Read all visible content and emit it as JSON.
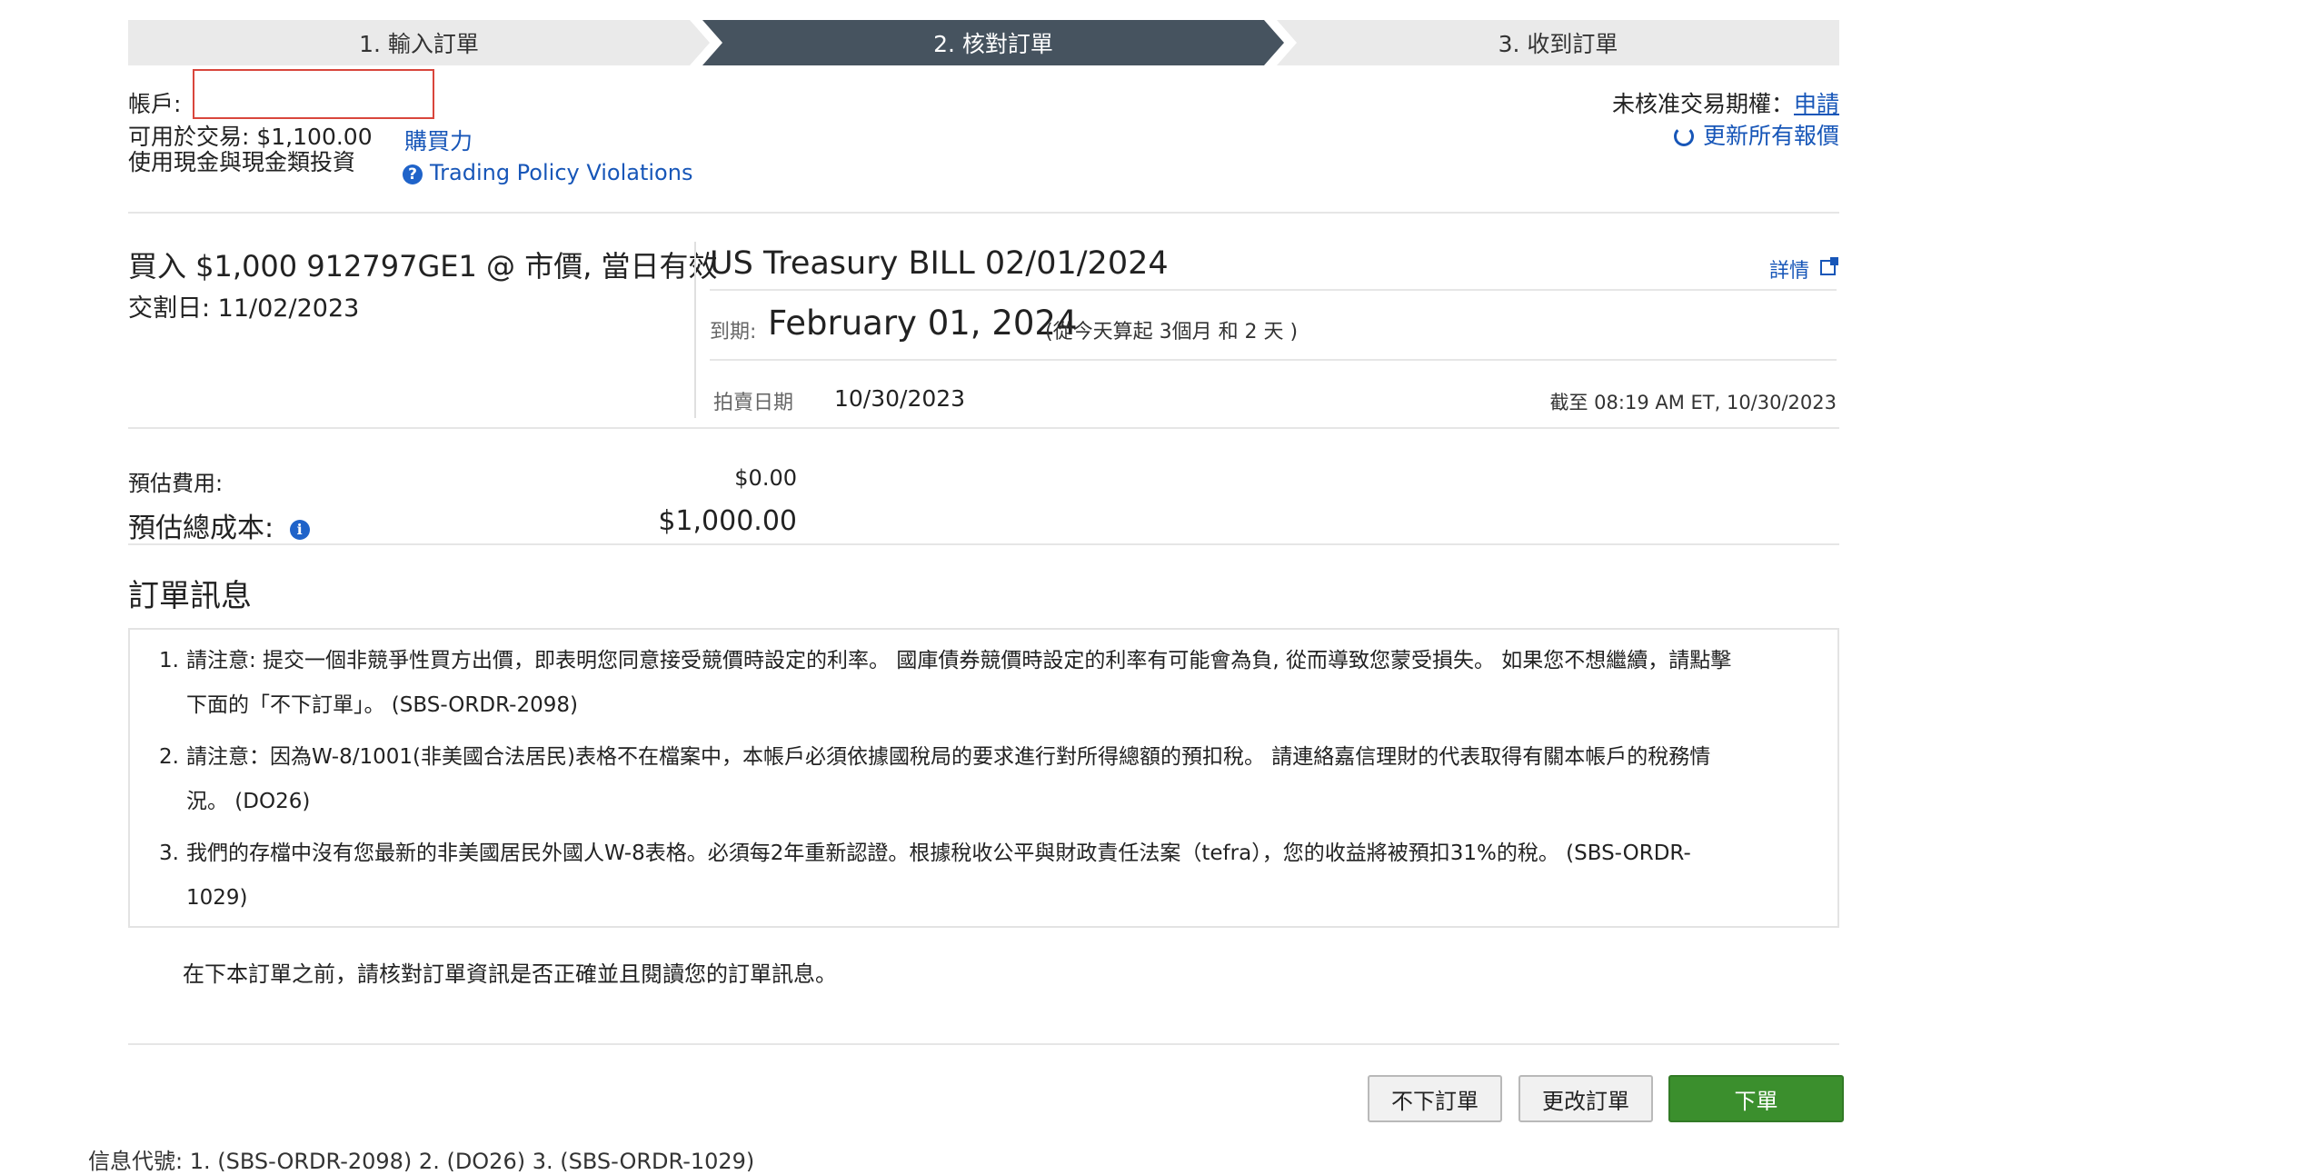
{
  "steps": [
    "1. 輸入訂單",
    "2. 核對訂單",
    "3. 收到訂單"
  ],
  "account": {
    "label": "帳戶:",
    "input_value": "",
    "available_label": "可用於交易: $1,100.00",
    "cash_note": "使用現金與現金類投資",
    "buying_power_link": "購買力",
    "policy_link": "Trading Policy Violations"
  },
  "top_right": {
    "unapproved_label": "未核准交易期權：",
    "apply_link": "申請",
    "refresh_link": "更新所有報價"
  },
  "order": {
    "summary": "買入 $1,000 912797GE1 @ 市價, 當日有效",
    "settlement": "交割日: 11/02/2023"
  },
  "security": {
    "name": "US Treasury BILL 02/01/2024",
    "details_link": "詳情",
    "maturity_label": "到期:",
    "maturity_date": "February 01, 2024",
    "maturity_note": "(從今天算起 3個月 和 2 天 )",
    "auction_label": "拍賣日期",
    "auction_date": "10/30/2023",
    "as_of": "截至 08:19 AM ET, 10/30/2023"
  },
  "costs": {
    "fee_label": "預估費用:",
    "fee_value": "$0.00",
    "total_label": "預估總成本:",
    "total_value": "$1,000.00"
  },
  "messages": {
    "heading": "訂單訊息",
    "items": [
      {
        "num": "1.",
        "text": "請注意: 提交一個非競爭性買方出價，即表明您同意接受競價時設定的利率。 國庫債券競價時設定的利率有可能會為負, 從而導致您蒙受損失。 如果您不想繼續，請點擊下面的「不下訂單」。 (SBS-ORDR-2098)"
      },
      {
        "num": "2.",
        "text": "請注意：因為W-8/1001(非美國合法居民)表格不在檔案中，本帳戶必須依據國稅局的要求進行對所得總額的預扣稅。 請連絡嘉信理財的代表取得有關本帳戶的稅務情況。 (DO26)"
      },
      {
        "num": "3.",
        "text": "我們的存檔中沒有您最新的非美國居民外國人W-8表格。必須每2年重新認證。根據稅收公平與財政責任法案（tefra），您的收益將被預扣31%的稅。 (SBS-ORDR-1029)"
      }
    ],
    "review_note": "在下本訂單之前，請核對訂單資訊是否正確並且閱讀您的訂單訊息。"
  },
  "buttons": {
    "cancel": "不下訂單",
    "change": "更改訂單",
    "place": "下單"
  },
  "footer": {
    "codes": "信息代號: 1. (SBS-ORDR-2098) 2. (DO26) 3. (SBS-ORDR-1029)"
  }
}
